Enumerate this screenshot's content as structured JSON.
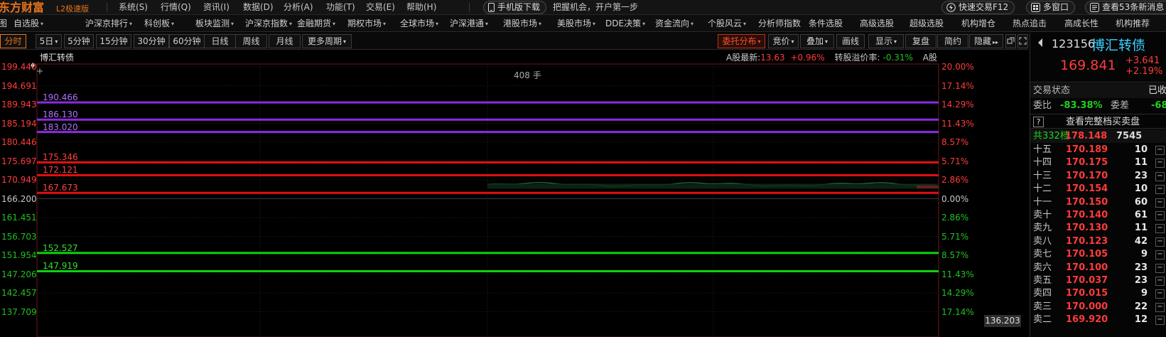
{
  "app": {
    "logo": "东方财富",
    "logo_sub": "L2极速版"
  },
  "menu": {
    "items": [
      "系统(S)",
      "行情(Q)",
      "资讯(I)",
      "数据(D)",
      "分析(A)",
      "功能(T)",
      "交易(E)",
      "帮助(H)"
    ],
    "mobile_download": "手机版下载",
    "slogan": "把握机会，开户第一步",
    "quick_trade": "快速交易F12",
    "multi_window": "多窗口",
    "news": "查看53条新消息"
  },
  "nav": {
    "items": [
      {
        "label": "图",
        "dd": false
      },
      {
        "label": "自选股",
        "dd": true
      },
      {
        "label": "沪深京排行",
        "dd": true
      },
      {
        "label": "科创板",
        "dd": true
      },
      {
        "label": "板块监测",
        "dd": true
      },
      {
        "label": "沪深京指数",
        "dd": true
      },
      {
        "label": "金融期货",
        "dd": true
      },
      {
        "label": "期权市场",
        "dd": true
      },
      {
        "label": "全球市场",
        "dd": true
      },
      {
        "label": "沪深港通",
        "dd": true
      },
      {
        "label": "港股市场",
        "dd": true
      },
      {
        "label": "美股市场",
        "dd": true
      },
      {
        "label": "DDE决策",
        "dd": true
      },
      {
        "label": "资金流向",
        "dd": true
      },
      {
        "label": "个股风云",
        "dd": true
      },
      {
        "label": "分析师指数",
        "dd": false
      },
      {
        "label": "条件选股",
        "dd": false
      },
      {
        "label": "高级选股",
        "dd": false
      },
      {
        "label": "超级选股",
        "dd": false
      },
      {
        "label": "机构增仓",
        "dd": false
      },
      {
        "label": "热点追击",
        "dd": false
      },
      {
        "label": "高成长性",
        "dd": false
      },
      {
        "label": "机构推荐",
        "dd": false
      }
    ]
  },
  "toolbar": {
    "periods": [
      "分时",
      "5日",
      "5分钟",
      "15分钟",
      "30分钟",
      "60分钟",
      "日线",
      "周线",
      "月线",
      "更多周期"
    ],
    "active_period": "分时",
    "tools": [
      "委托分布",
      "竞价",
      "叠加",
      "画线",
      "显示",
      "复盘",
      "简约",
      "隐藏"
    ]
  },
  "chart": {
    "stock_name": "博汇转债",
    "a_share_latest_label": "A股最新:",
    "a_share_latest": "13.63",
    "a_share_change": "+0.96%",
    "premium_label": "转股溢价率:",
    "premium": "-0.31%",
    "a_tag": "A股",
    "volume_label": "408 手",
    "current_price_box": "136.203"
  },
  "chart_data": {
    "type": "line",
    "title": "博汇转债",
    "xlabel": "",
    "ylabel": "",
    "ylim": [
      137.709,
      199.44
    ],
    "ylim_visible": [
      136.203,
      199.44
    ],
    "pre_close": 166.2,
    "y_ticks_left": [
      "199.440",
      "194.691",
      "189.943",
      "185.194",
      "180.446",
      "175.697",
      "170.949",
      "166.200",
      "161.451",
      "156.703",
      "151.954",
      "147.206",
      "142.457",
      "137.709"
    ],
    "y_ticks_right": [
      "20.00%",
      "17.14%",
      "14.29%",
      "11.43%",
      "8.57%",
      "5.71%",
      "2.86%",
      "0.00%",
      "2.86%",
      "5.71%",
      "8.57%",
      "11.43%",
      "14.29%",
      "17.14%"
    ],
    "order_levels": [
      {
        "label": "190.466",
        "value": 190.466,
        "side": "sell"
      },
      {
        "label": "186.130",
        "value": 186.13,
        "side": "sell"
      },
      {
        "label": "183.020",
        "value": 183.02,
        "side": "sell"
      },
      {
        "label": "175.346",
        "value": 175.346,
        "side": "ask"
      },
      {
        "label": "172.121",
        "value": 172.121,
        "side": "ask"
      },
      {
        "label": "167.673",
        "value": 167.673,
        "side": "ask"
      },
      {
        "label": "152.527",
        "value": 152.527,
        "side": "bid"
      },
      {
        "label": "147.919",
        "value": 147.919,
        "side": "bid"
      }
    ],
    "grid": true,
    "colors": {
      "sell": "#8a2be2",
      "ask": "#e01010",
      "bid": "#10d010",
      "up": "#ff3b3b",
      "down": "#20c020"
    }
  },
  "panel": {
    "code": "123156",
    "name": "博汇转债",
    "last_price": "169.841",
    "change": "+3.641",
    "change_pct": "+2.19%",
    "trade_status_label": "交易状态",
    "trade_status": "已收",
    "weibi_label": "委比",
    "weibi": "-83.38%",
    "weicha_label": "委差",
    "weicha": "-68",
    "full_book_link": "查看完整档买卖盘",
    "total_label": "共332档",
    "total_price": "178.148",
    "total_vol": "7545",
    "asks": [
      {
        "label": "十五",
        "price": "170.189",
        "vol": "10"
      },
      {
        "label": "十四",
        "price": "170.175",
        "vol": "11"
      },
      {
        "label": "十三",
        "price": "170.170",
        "vol": "23"
      },
      {
        "label": "十二",
        "price": "170.154",
        "vol": "10"
      },
      {
        "label": "十一",
        "price": "170.150",
        "vol": "60"
      },
      {
        "label": "卖十",
        "price": "170.140",
        "vol": "61"
      },
      {
        "label": "卖九",
        "price": "170.130",
        "vol": "11"
      },
      {
        "label": "卖八",
        "price": "170.123",
        "vol": "42"
      },
      {
        "label": "卖七",
        "price": "170.105",
        "vol": "9"
      },
      {
        "label": "卖六",
        "price": "170.100",
        "vol": "23"
      },
      {
        "label": "卖五",
        "price": "170.037",
        "vol": "23"
      },
      {
        "label": "卖四",
        "price": "170.015",
        "vol": "9"
      },
      {
        "label": "卖三",
        "price": "170.000",
        "vol": "22"
      },
      {
        "label": "卖二",
        "price": "169.920",
        "vol": "12"
      }
    ]
  }
}
